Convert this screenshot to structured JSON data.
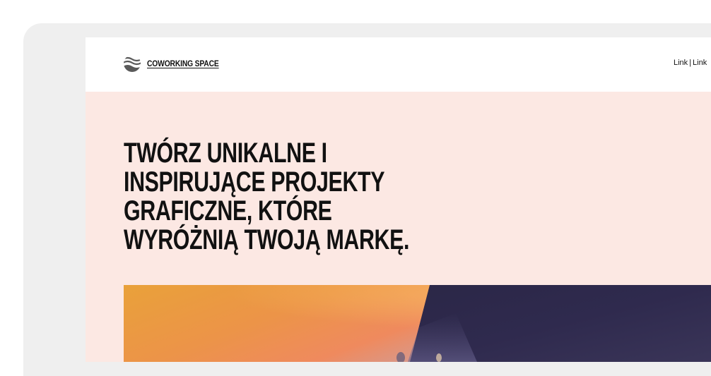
{
  "site": {
    "logo_text": "COWORKING SPACE",
    "logo_icon": "wave-stack-icon"
  },
  "nav": {
    "links": [
      "Link",
      "Link"
    ]
  },
  "hero": {
    "title": "TWÓRZ UNIKALNE I INSPIRUJĄCE PROJEKTY GRAFICZNE, KTÓRE WYRÓŻNIĄ TWOJĄ MARKĘ."
  },
  "colors": {
    "page_background": "#ffffff",
    "device_frame": "#efefef",
    "hero_background": "#fce8e3",
    "header_background": "#ffffff",
    "text": "#111111",
    "image_orange": "#e9a13a",
    "image_coral": "#ef8a5e",
    "image_navy": "#2f2a4e"
  }
}
